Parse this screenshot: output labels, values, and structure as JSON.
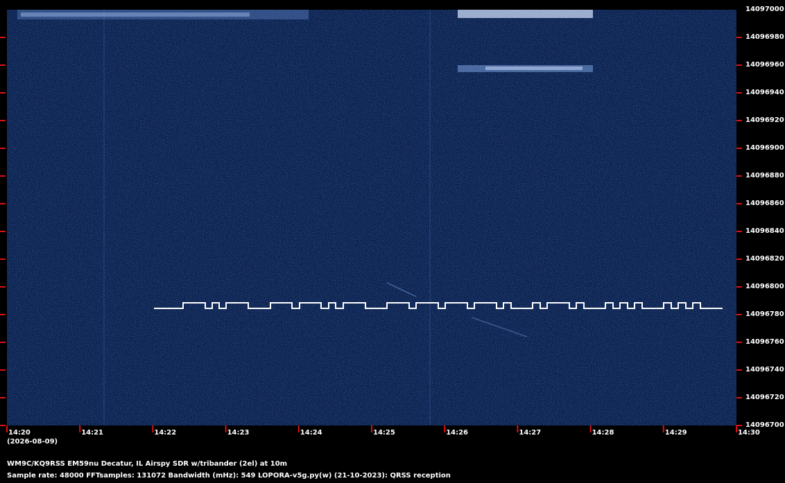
{
  "colors": {
    "background": "#000000",
    "waterfall": "#0b2250",
    "tick": "#e01010",
    "trace": "#ffffff"
  },
  "y_axis": {
    "labels": [
      "14097000",
      "14096980",
      "14096960",
      "14096940",
      "14096920",
      "14096900",
      "14096880",
      "14096860",
      "14096840",
      "14096820",
      "14096800",
      "14096780",
      "14096760",
      "14096740",
      "14096720",
      "14096700"
    ]
  },
  "x_axis": {
    "labels": [
      "14:20",
      "14:21",
      "14:22",
      "14:23",
      "14:24",
      "14:25",
      "14:26",
      "14:27",
      "14:28",
      "14:29",
      "14:30"
    ],
    "date": "(2026-08-09)"
  },
  "info": {
    "station": "WM9C/KQ9RSS EM59nu Decatur, IL  Airspy SDR w/tribander (2el) at 10m",
    "sample_rate": "Sample rate: 48000",
    "fft_samples": "FFTsamples: 131072",
    "bandwidth": "Bandwidth (mHz): 549",
    "software": "LOPORA-v5g.py(w) (21-10-2023): QRSS reception"
  }
}
